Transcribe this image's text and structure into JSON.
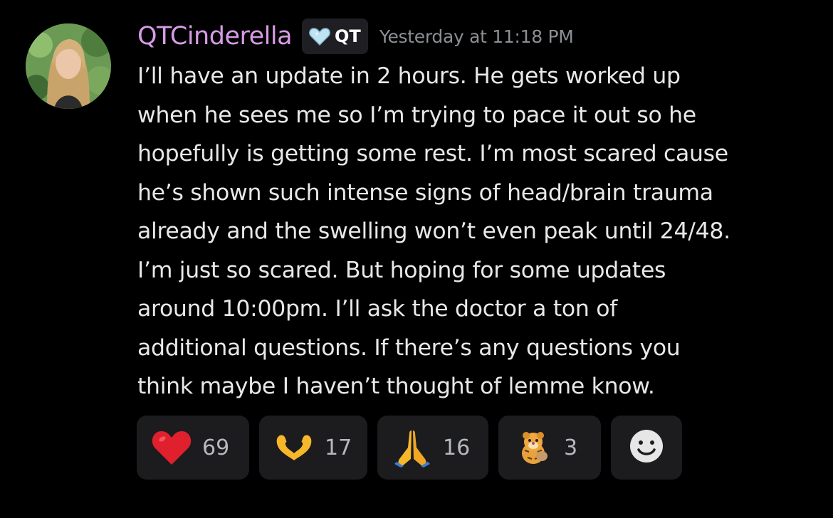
{
  "author": {
    "username": "QTCinderella",
    "tag": "QT",
    "tag_icon": "heart-badge-icon",
    "timestamp": "Yesterday at 11:18 PM",
    "username_color": "#d79be6"
  },
  "message": {
    "lines": [
      "I’ll have an update in 2 hours. He gets worked up",
      "when he sees me so I’m trying to pace it out so he",
      "hopefully is getting some rest. I’m most scared cause",
      "he’s shown such intense signs of head/brain trauma",
      "already and the swelling won’t even peak until 24/48.",
      "I’m just so scared. But hoping for some updates",
      "around 10:00pm. I’ll ask the doctor a ton of",
      "additional questions. If there’s any questions you",
      "think maybe I haven’t thought of lemme know."
    ]
  },
  "reactions": [
    {
      "emoji": "red-heart-icon",
      "count": "69"
    },
    {
      "emoji": "heart-hands-icon",
      "count": "17"
    },
    {
      "emoji": "folded-hands-icon",
      "count": "16"
    },
    {
      "emoji": "tigger-sticker-icon",
      "count": "3"
    }
  ],
  "add_reaction": {
    "icon": "smiley-add-reaction-icon"
  }
}
